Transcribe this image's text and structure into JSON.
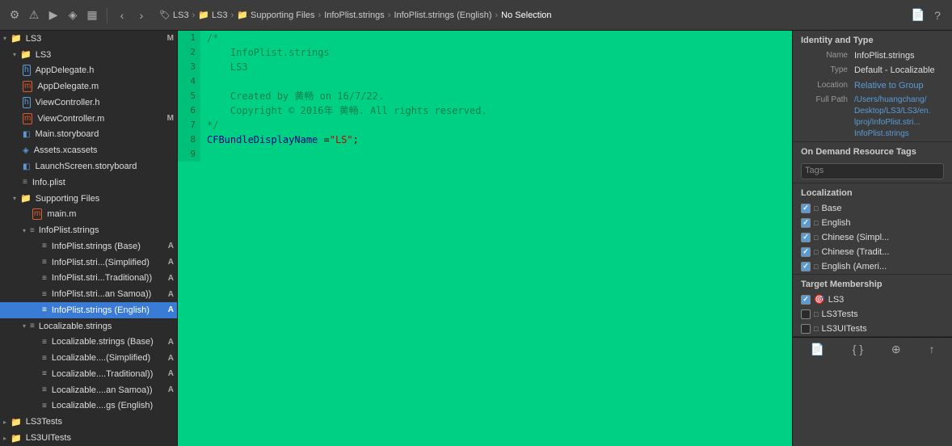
{
  "toolbar": {
    "breadcrumbs": [
      "LS3",
      "LS3",
      "Supporting Files",
      "InfoPlist.strings",
      "InfoPlist.strings (English)",
      "No Selection"
    ],
    "nav_back": "‹",
    "nav_forward": "›"
  },
  "sidebar": {
    "root_label": "LS3",
    "items": [
      {
        "id": "LS3",
        "label": "LS3",
        "indent": 0,
        "type": "group",
        "badge": ""
      },
      {
        "id": "AppDelegate.h",
        "label": "AppDelegate.h",
        "indent": 1,
        "type": "h",
        "badge": ""
      },
      {
        "id": "AppDelegate.m",
        "label": "AppDelegate.m",
        "indent": 1,
        "type": "m",
        "badge": ""
      },
      {
        "id": "ViewController.h",
        "label": "ViewController.h",
        "indent": 1,
        "type": "h",
        "badge": ""
      },
      {
        "id": "ViewController.m",
        "label": "ViewController.m",
        "indent": 1,
        "type": "m",
        "badge": "M"
      },
      {
        "id": "Main.storyboard",
        "label": "Main.storyboard",
        "indent": 1,
        "type": "storyboard",
        "badge": ""
      },
      {
        "id": "Assets.xcassets",
        "label": "Assets.xcassets",
        "indent": 1,
        "type": "xcassets",
        "badge": ""
      },
      {
        "id": "LaunchScreen.storyboard",
        "label": "LaunchScreen.storyboard",
        "indent": 1,
        "type": "storyboard",
        "badge": ""
      },
      {
        "id": "Info.plist",
        "label": "Info.plist",
        "indent": 1,
        "type": "plist",
        "badge": ""
      },
      {
        "id": "SupportingFiles",
        "label": "Supporting Files",
        "indent": 1,
        "type": "folder",
        "badge": ""
      },
      {
        "id": "main.m",
        "label": "main.m",
        "indent": 2,
        "type": "m",
        "badge": ""
      },
      {
        "id": "InfoPlist.strings",
        "label": "InfoPlist.strings",
        "indent": 2,
        "type": "strings-group",
        "badge": ""
      },
      {
        "id": "InfoPlist.strings.Base",
        "label": "InfoPlist.strings (Base)",
        "indent": 3,
        "type": "strings",
        "badge": "A"
      },
      {
        "id": "InfoPlist.stri.Simplified",
        "label": "InfoPlist.stri...(Simplified)",
        "indent": 3,
        "type": "strings",
        "badge": "A"
      },
      {
        "id": "InfoPlist.stri.Traditional",
        "label": "InfoPlist.stri...Traditional))",
        "indent": 3,
        "type": "strings",
        "badge": "A"
      },
      {
        "id": "InfoPlist.stri.Samoa",
        "label": "InfoPlist.stri...an Samoa))",
        "indent": 3,
        "type": "strings",
        "badge": "A"
      },
      {
        "id": "InfoPlist.strings.English",
        "label": "InfoPlist.strings (English)",
        "indent": 3,
        "type": "strings",
        "badge": "A",
        "selected": true
      },
      {
        "id": "Localizable.strings",
        "label": "Localizable.strings",
        "indent": 2,
        "type": "strings-group",
        "badge": ""
      },
      {
        "id": "Localizable.strings.Base",
        "label": "Localizable.strings (Base)",
        "indent": 3,
        "type": "strings",
        "badge": "A"
      },
      {
        "id": "Localizable.Simplified",
        "label": "Localizable....(Simplified)",
        "indent": 3,
        "type": "strings",
        "badge": "A"
      },
      {
        "id": "Localizable.Traditional",
        "label": "Localizable....Traditional))",
        "indent": 3,
        "type": "strings",
        "badge": "A"
      },
      {
        "id": "Localizable.Samoa",
        "label": "Localizable....an Samoa))",
        "indent": 3,
        "type": "strings",
        "badge": "A"
      },
      {
        "id": "Localizable.gs.English",
        "label": "Localizable....gs (English)",
        "indent": 3,
        "type": "strings",
        "badge": ""
      }
    ],
    "bottom_groups": [
      {
        "id": "LS3Tests",
        "label": "LS3Tests"
      },
      {
        "id": "LS3UITests",
        "label": "LS3UITests"
      }
    ]
  },
  "editor": {
    "lines": [
      {
        "num": 1,
        "text": "/*"
      },
      {
        "num": 2,
        "text": "    InfoPlist.strings"
      },
      {
        "num": 3,
        "text": "    LS3"
      },
      {
        "num": 4,
        "text": ""
      },
      {
        "num": 5,
        "text": "    Created by 黄畅 on 16/7/22."
      },
      {
        "num": 6,
        "text": "    Copyright © 2016年 黄畅. All rights reserved."
      },
      {
        "num": 7,
        "text": "*/"
      },
      {
        "num": 8,
        "text": "CFBundleDisplayName =\"LS\";"
      },
      {
        "num": 9,
        "text": ""
      }
    ]
  },
  "inspector": {
    "title": "Identity and Type",
    "name_label": "Name",
    "name_value": "InfoPlist.strings",
    "type_label": "Type",
    "type_value": "Default - Localizable",
    "location_label": "Location",
    "location_value": "Relative to Group",
    "full_path_label": "Full Path",
    "full_path_value": "/Users/huangchang/ Desktop/LS3/LS3/en. lproj/InfoPlist.stri... InfoPlist.strings",
    "on_demand_title": "On Demand Resource Tags",
    "tags_placeholder": "Tags",
    "localization_title": "Localization",
    "localizations": [
      {
        "label": "Base",
        "checked": true
      },
      {
        "label": "English",
        "checked": true
      },
      {
        "label": "Chinese (Simpl...",
        "checked": true
      },
      {
        "label": "Chinese (Tradit...",
        "checked": true
      },
      {
        "label": "English (Ameri...",
        "checked": true
      }
    ],
    "target_title": "Target Membership",
    "targets": [
      {
        "label": "LS3",
        "checked": true,
        "type": "target"
      },
      {
        "label": "LS3Tests",
        "checked": false,
        "type": "folder"
      },
      {
        "label": "LS3UITests",
        "checked": false,
        "type": "folder"
      }
    ],
    "bottom_icons": [
      "doc",
      "code",
      "link",
      "share"
    ]
  }
}
